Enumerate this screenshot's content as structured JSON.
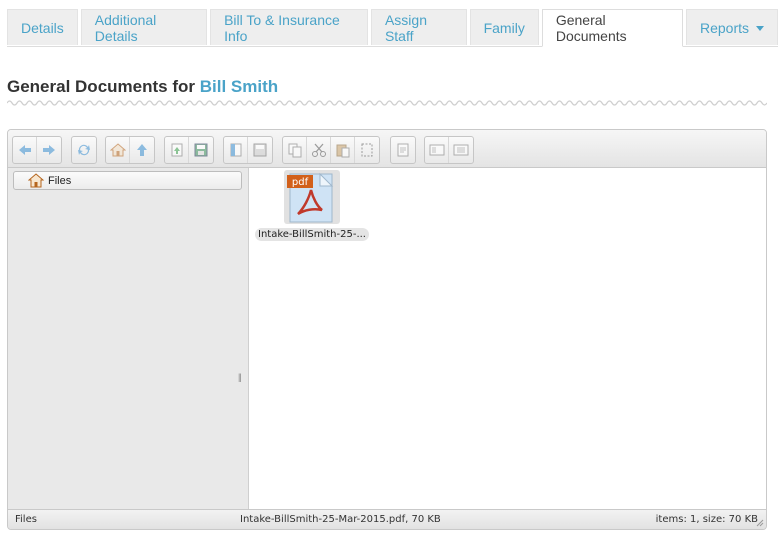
{
  "tabs": [
    {
      "label": "Details",
      "active": false
    },
    {
      "label": "Additional Details",
      "active": false
    },
    {
      "label": "Bill To & Insurance Info",
      "active": false
    },
    {
      "label": "Assign Staff",
      "active": false
    },
    {
      "label": "Family",
      "active": false
    },
    {
      "label": "General Documents",
      "active": true
    },
    {
      "label": "Reports",
      "active": false,
      "dropdown": true
    }
  ],
  "page": {
    "title_prefix": "General Documents for",
    "client_name": "Bill Smith"
  },
  "file_manager": {
    "tree_root": "Files",
    "files": [
      {
        "name": "Intake-BillSmith-25-...",
        "type_badge": "pdf"
      }
    ],
    "status": {
      "path": "Files",
      "selection": "Intake-BillSmith-25-Mar-2015.pdf, 70 KB",
      "summary": "items: 1, size: 70 KB"
    }
  },
  "colors": {
    "accent": "#4aa3c8",
    "pdf_badge": "#d2601a"
  }
}
